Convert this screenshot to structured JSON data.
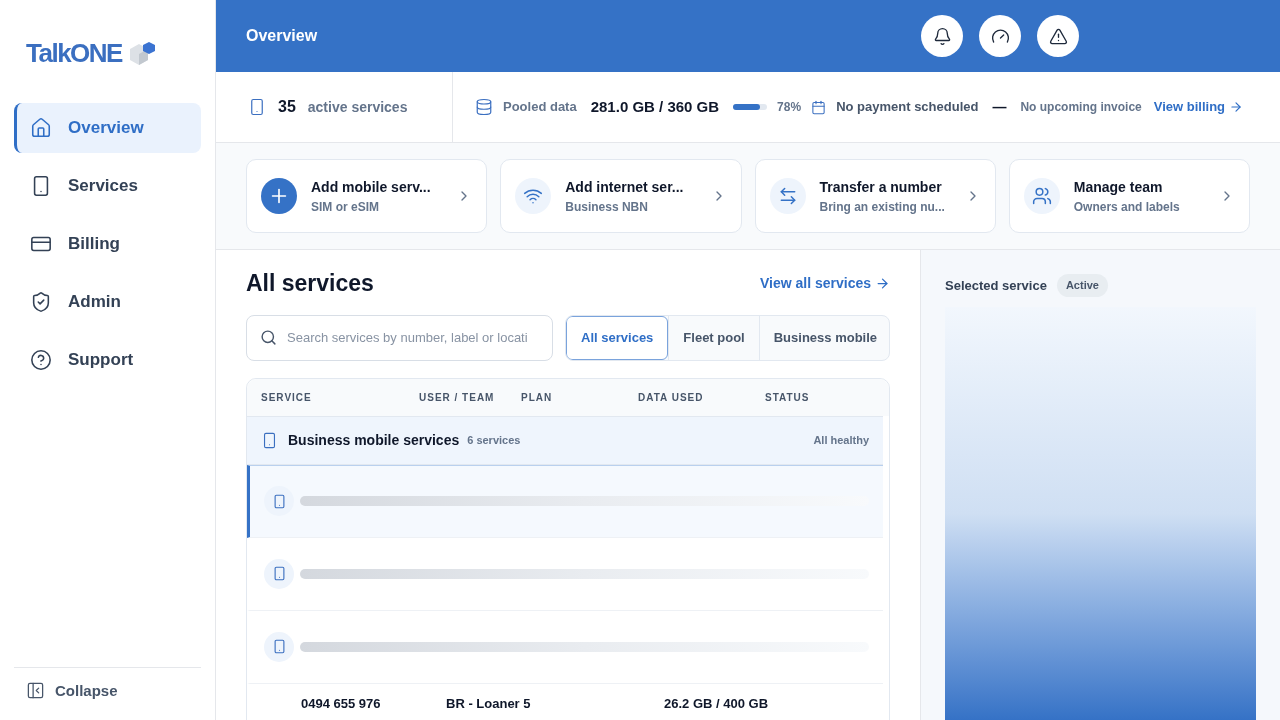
{
  "brand": {
    "name": "TalkONE"
  },
  "nav": [
    {
      "label": "Overview",
      "selected": true
    },
    {
      "label": "Services",
      "selected": false
    },
    {
      "label": "Billing",
      "selected": false
    },
    {
      "label": "Admin",
      "selected": false
    },
    {
      "label": "Support",
      "selected": false
    }
  ],
  "collapse": "Collapse",
  "header": {
    "title": "Overview"
  },
  "stats": {
    "count": "35",
    "count_label": "active services",
    "pooled_label": "Pooled data",
    "pooled_value": "281.0 GB / 360 GB",
    "level": 0.78,
    "percent": "78%",
    "payment": "No payment scheduled",
    "dash": "—",
    "invoice": "No upcoming invoice",
    "billing_link": "View billing"
  },
  "quick_actions": [
    {
      "title": "Add mobile serv...",
      "subtitle": "SIM or eSIM",
      "primary": true
    },
    {
      "title": "Add internet ser...",
      "subtitle": "Business NBN",
      "primary": false
    },
    {
      "title": "Transfer a number",
      "subtitle": "Bring an existing nu...",
      "primary": false
    },
    {
      "title": "Manage team",
      "subtitle": "Owners and labels",
      "primary": false
    }
  ],
  "services": {
    "title": "All services",
    "view_all": "View all services",
    "search_placeholder": "Search services by number, label or locati",
    "filters": [
      {
        "label": "All services",
        "selected": true
      },
      {
        "label": "Fleet pool",
        "selected": false
      },
      {
        "label": "Business mobile",
        "selected": false
      }
    ],
    "columns": [
      "SERVICE",
      "USER / TEAM",
      "PLAN",
      "DATA USED",
      "STATUS"
    ],
    "group": {
      "name": "Business mobile services",
      "count": "6 services",
      "status": "All healthy"
    },
    "rows": [
      {
        "selected": true
      },
      {
        "selected": false
      },
      {
        "selected": false
      }
    ],
    "last_row": {
      "number": "0494 655 976",
      "user": "BR - Loaner 5",
      "data": "26.2 GB / 400 GB"
    }
  },
  "detail": {
    "title": "Selected service",
    "badge": "Active"
  }
}
